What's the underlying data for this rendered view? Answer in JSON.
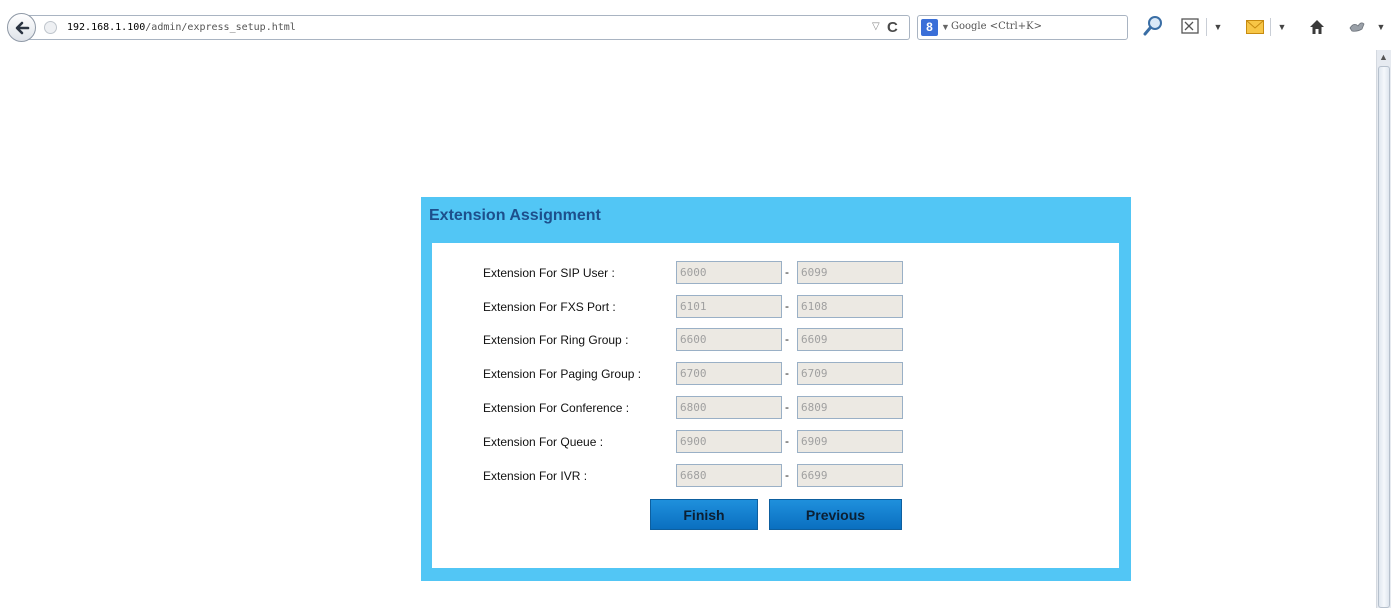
{
  "browser": {
    "url_host": "192.168.1.100",
    "url_path": "/admin/express_setup.html",
    "search_placeholder": "Google <Ctrl+K>",
    "icons": [
      "back-arrow-icon",
      "globe-icon",
      "reload-icon",
      "google-icon",
      "magnifier-icon",
      "screenshot-icon",
      "mail-icon",
      "home-icon",
      "addon-icon"
    ]
  },
  "panel": {
    "title": "Extension Assignment",
    "rows": [
      {
        "label": "Extension For SIP User :",
        "start": "6000",
        "end": "6099"
      },
      {
        "label": "Extension For FXS Port :",
        "start": "6101",
        "end": "6108"
      },
      {
        "label": "Extension For Ring Group :",
        "start": "6600",
        "end": "6609"
      },
      {
        "label": "Extension For Paging Group :",
        "start": "6700",
        "end": "6709"
      },
      {
        "label": "Extension For Conference :",
        "start": "6800",
        "end": "6809"
      },
      {
        "label": "Extension For Queue :",
        "start": "6900",
        "end": "6909"
      },
      {
        "label": "Extension For IVR :",
        "start": "6680",
        "end": "6699"
      }
    ],
    "separator": "-",
    "finish_label": "Finish",
    "previous_label": "Previous"
  },
  "colors": {
    "panel_bg": "#52c6f5",
    "title_text": "#1d4f8c",
    "button_bg": "#0a7fd0",
    "input_bg": "#ece9e3"
  }
}
